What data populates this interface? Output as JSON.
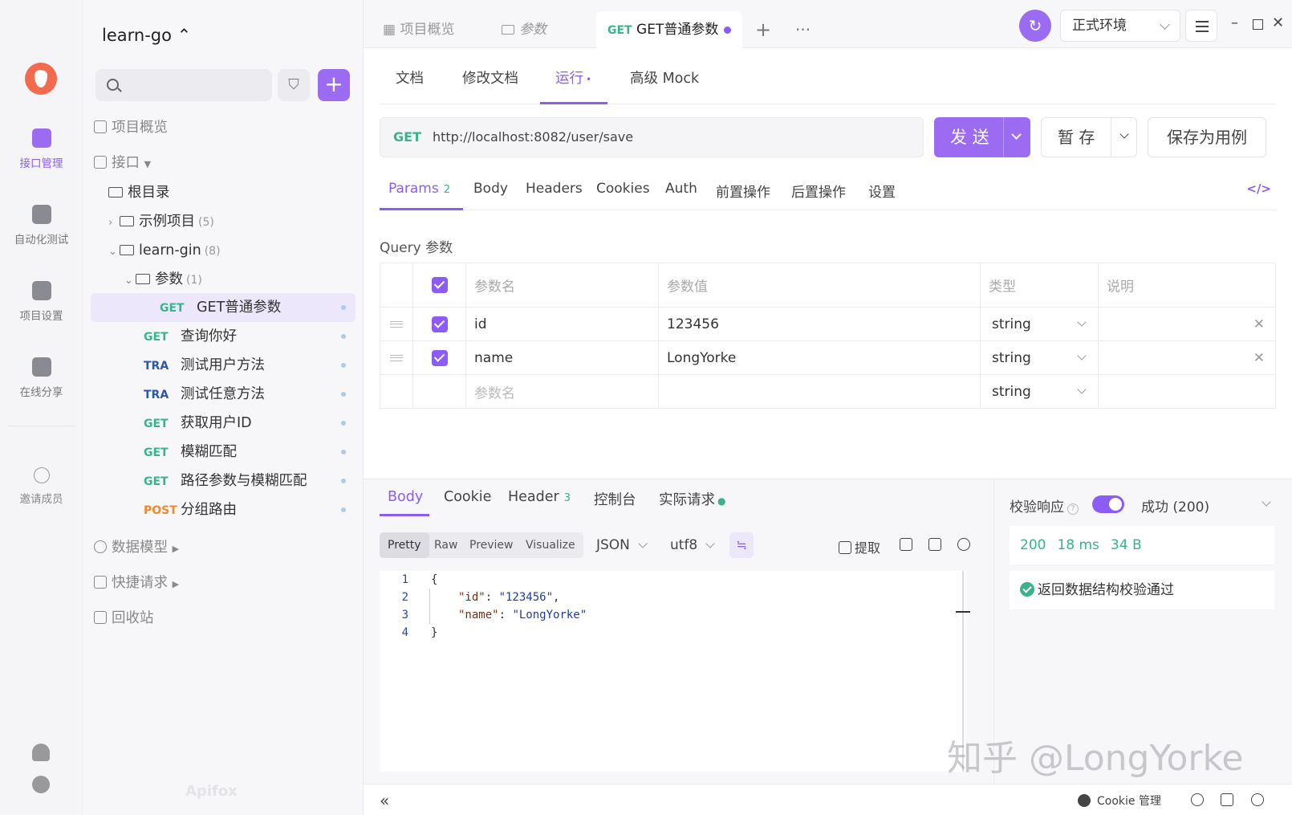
{
  "rail": {
    "items": [
      {
        "label": "接口管理",
        "icon": "api-management-icon"
      },
      {
        "label": "自动化测试",
        "icon": "automation-test-icon"
      },
      {
        "label": "项目设置",
        "icon": "project-settings-icon"
      },
      {
        "label": "在线分享",
        "icon": "online-share-icon"
      },
      {
        "label": "邀请成员",
        "icon": "invite-member-icon"
      }
    ]
  },
  "tree": {
    "project": "learn-go",
    "overview": "项目概览",
    "api_section": "接口",
    "root": "根目录",
    "folders": [
      {
        "label": "示例项目",
        "count": "(5)"
      },
      {
        "label": "learn-gin",
        "count": "(8)"
      },
      {
        "label": "参数",
        "count": "(1)"
      }
    ],
    "apis": [
      {
        "method": "GET",
        "label": "GET普通参数"
      },
      {
        "method": "GET",
        "label": "查询你好"
      },
      {
        "method": "TRA",
        "label": "测试用户方法"
      },
      {
        "method": "TRA",
        "label": "测试任意方法"
      },
      {
        "method": "GET",
        "label": "获取用户ID"
      },
      {
        "method": "GET",
        "label": "模糊匹配"
      },
      {
        "method": "GET",
        "label": "路径参数与模糊匹配"
      },
      {
        "method": "POST",
        "label": "分组路由"
      }
    ],
    "data_model": "数据模型",
    "quick_request": "快捷请求",
    "trash": "回收站",
    "brand": "Apifox"
  },
  "tabs": {
    "overview": "项目概览",
    "params": "参数",
    "active_method": "GET",
    "active_label": "GET普通参数",
    "env": "正式环境"
  },
  "subtabs": [
    "文档",
    "修改文档",
    "运行",
    "高级 Mock"
  ],
  "request": {
    "method": "GET",
    "url": "http://localhost:8082/user/save",
    "send": "发 送",
    "save": "暂 存",
    "save_case": "保存为用例"
  },
  "param_tabs": {
    "params": "Params",
    "params_count": "2",
    "body": "Body",
    "headers": "Headers",
    "cookies": "Cookies",
    "auth": "Auth",
    "pre": "前置操作",
    "post": "后置操作",
    "settings": "设置",
    "code": "</>"
  },
  "query": {
    "title": "Query 参数",
    "headers": [
      "参数名",
      "参数值",
      "类型",
      "说明"
    ],
    "rows": [
      {
        "name": "id",
        "value": "123456",
        "type": "string"
      },
      {
        "name": "name",
        "value": "LongYorke",
        "type": "string"
      }
    ],
    "placeholder_name": "参数名",
    "placeholder_type": "string"
  },
  "response": {
    "tabs": {
      "body": "Body",
      "cookie": "Cookie",
      "header": "Header",
      "header_count": "3",
      "console": "控制台",
      "actual": "实际请求"
    },
    "formats": [
      "Pretty",
      "Raw",
      "Preview",
      "Visualize"
    ],
    "lang": "JSON",
    "encoding": "utf8",
    "extract": "提取",
    "code_lines": [
      "1",
      "2",
      "3",
      "4"
    ],
    "json": {
      "open": "{",
      "id_key": "\"id\"",
      "id_val": "\"123456\"",
      "name_key": "\"name\"",
      "name_val": "\"LongYorke\"",
      "close": "}"
    }
  },
  "verify": {
    "label": "校验响应",
    "result": "成功 (200)",
    "status": "200",
    "time": "18 ms",
    "size": "34 B",
    "message": "返回数据结构校验通过"
  },
  "statusbar": {
    "cookie_mgr": "Cookie 管理"
  },
  "watermark": "知乎 @LongYorke",
  "colors": {
    "accent": "#8b5cf6",
    "get": "#3ab38b",
    "tra": "#2c58a9",
    "post": "#f08a2b"
  }
}
